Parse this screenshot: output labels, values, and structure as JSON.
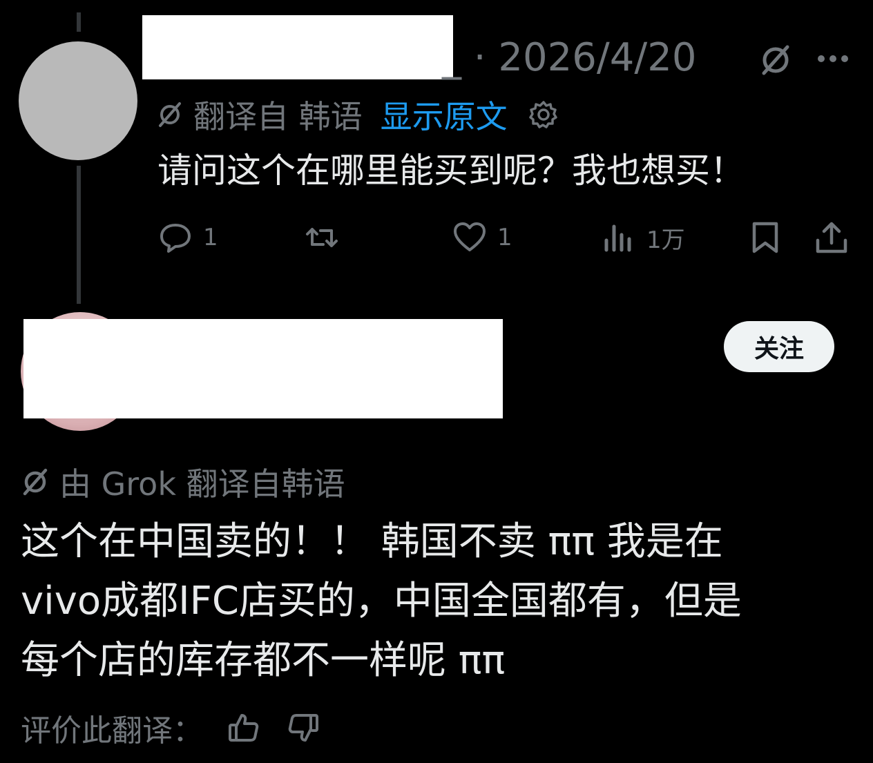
{
  "colors": {
    "background": "#000000",
    "text": "#e7e9ea",
    "muted": "#71767b",
    "link": "#1d9bf0",
    "follow_bg": "#eff3f4"
  },
  "first_tweet": {
    "meta": "_ · 2026/4/20",
    "translation": {
      "label": "翻译自 韩语",
      "show_original": "显示原文",
      "icon": "grok-icon",
      "settings_icon": "gear-icon"
    },
    "text": "请问这个在哪里能买到呢？我也想买！",
    "actions": {
      "reply_count": "1",
      "repost_count": "",
      "like_count": "1",
      "views_count": "1万"
    }
  },
  "second_tweet": {
    "follow_label": "关注",
    "grok_label": "由 Grok 翻译自韩语",
    "text_lines": [
      "这个在中国卖的！！ 韩国不卖 ππ 我是在",
      "vivo成都IFC店买的，中国全国都有，但是",
      "每个店的库存都不一样呢 ππ"
    ],
    "rate_label": "评价此翻译："
  }
}
